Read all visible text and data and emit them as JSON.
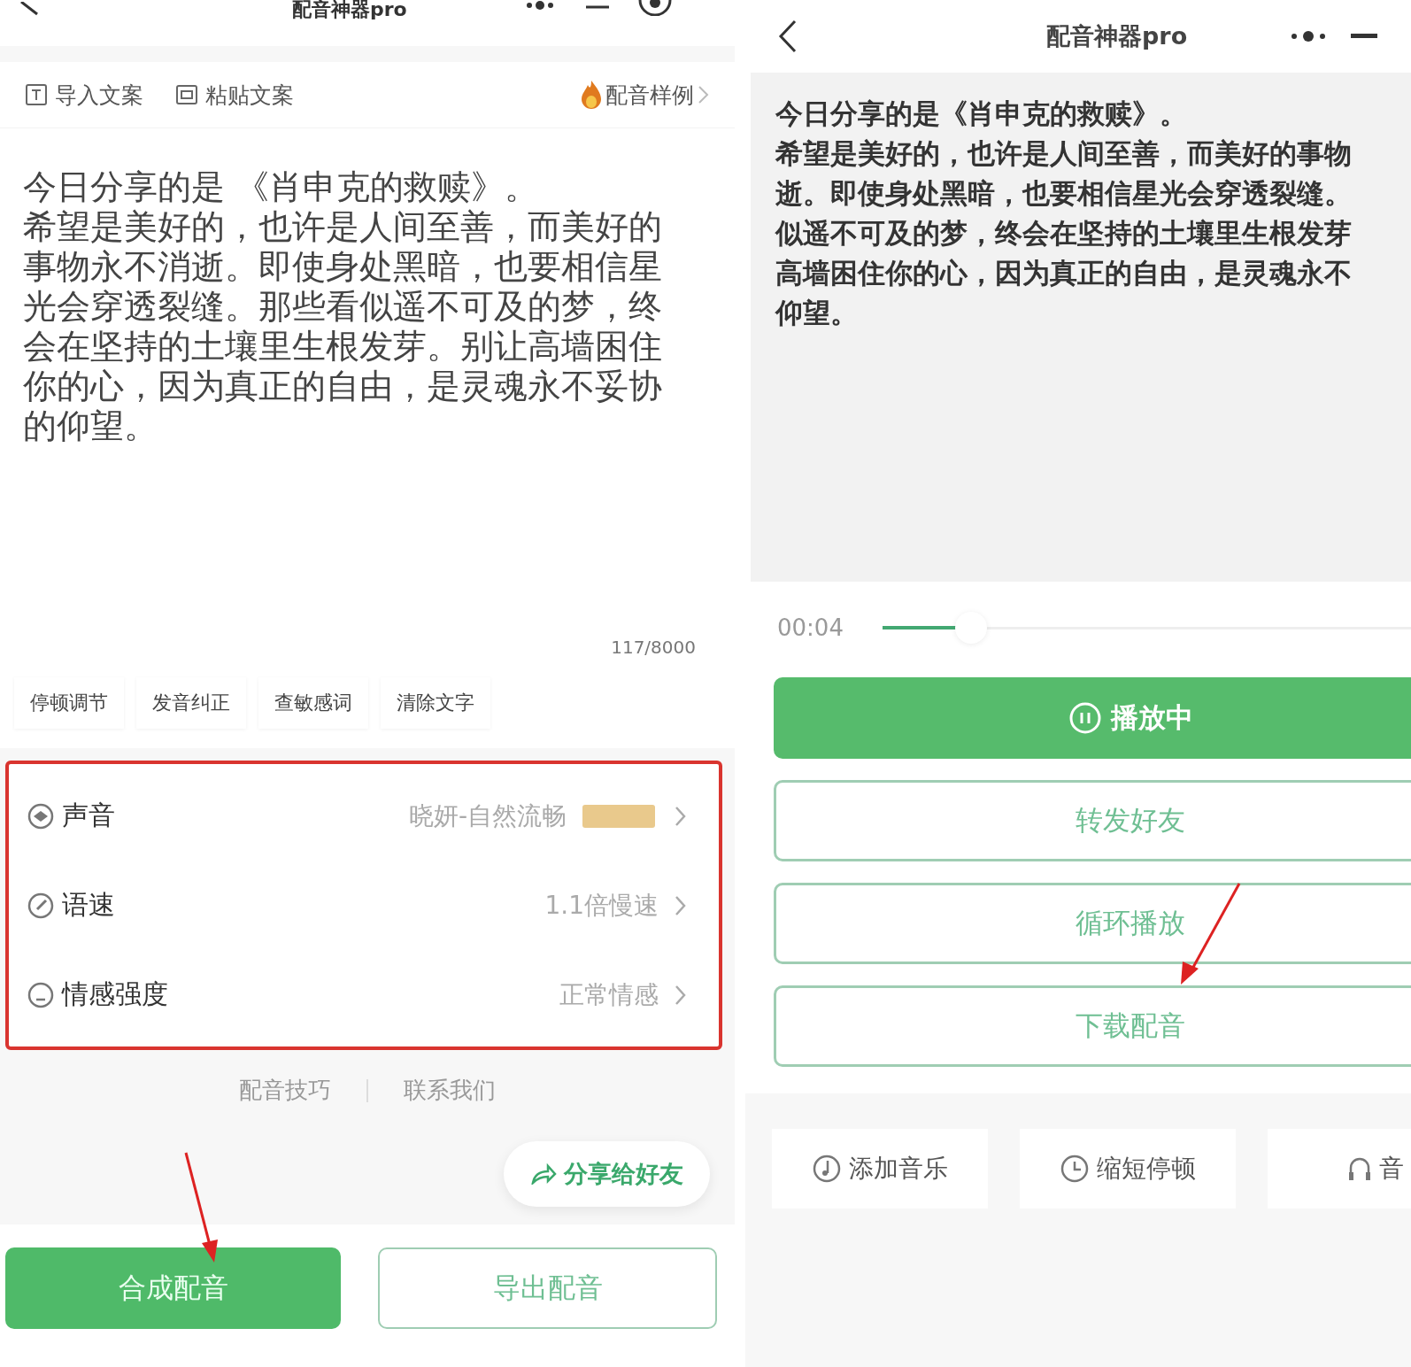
{
  "left": {
    "title": "配音神器pro",
    "toolbar": [
      {
        "kind": "import",
        "label": "导入文案"
      },
      {
        "kind": "paste",
        "label": "粘贴文案"
      }
    ],
    "sample_link": "配音样例",
    "text_first_line": "今日分享的是 《肖申克的救赎》。",
    "text_rest": "希望是美好的，也许是人间至善，而美好的事物永不消逝。即使身处黑暗，也要相信星光会穿透裂缝。那些看似遥不可及的梦，终会在坚持的土壤里生根发芽。别让高墙困住你的心，因为真正的自由，是灵魂永不妥协的仰望。",
    "counter": "117/8000",
    "chips": [
      "停顿调节",
      "发音纠正",
      "查敏感词",
      "清除文字"
    ],
    "settings": [
      {
        "kind": "voice",
        "label": "声音",
        "value": "晓妍-自然流畅",
        "badge": true
      },
      {
        "kind": "speed",
        "label": "语速",
        "value": "1.1倍慢速",
        "badge": false
      },
      {
        "kind": "emotion",
        "label": "情感强度",
        "value": "正常情感",
        "badge": false
      }
    ],
    "links": [
      "配音技巧",
      "联系我们"
    ],
    "share": "分享给好友",
    "buttons": [
      {
        "label": "合成配音",
        "primary": true
      },
      {
        "label": "导出配音",
        "primary": false
      }
    ]
  },
  "right": {
    "title": "配音神器pro",
    "text_lines": [
      "今日分享的是《肖申克的救赎》。",
      "希望是美好的，也许是人间至善，而美好的事物",
      "逝。即使身处黑暗，也要相信星光会穿透裂缝。",
      "似遥不可及的梦，终会在坚持的土壤里生根发芽",
      "高墙困住你的心，因为真正的自由，是灵魂永不",
      "仰望。"
    ],
    "player": {
      "time": "00:04",
      "level": 0.14
    },
    "buttons": [
      {
        "label": "播放中",
        "primary": true
      },
      {
        "label": "转发好友",
        "primary": false
      },
      {
        "label": "循环播放",
        "primary": false
      },
      {
        "label": "下载配音",
        "primary": false
      }
    ],
    "tools": [
      {
        "kind": "music",
        "label": "添加音乐"
      },
      {
        "kind": "clock",
        "label": "缩短停顿"
      },
      {
        "kind": "headphones",
        "label": "音"
      }
    ]
  }
}
